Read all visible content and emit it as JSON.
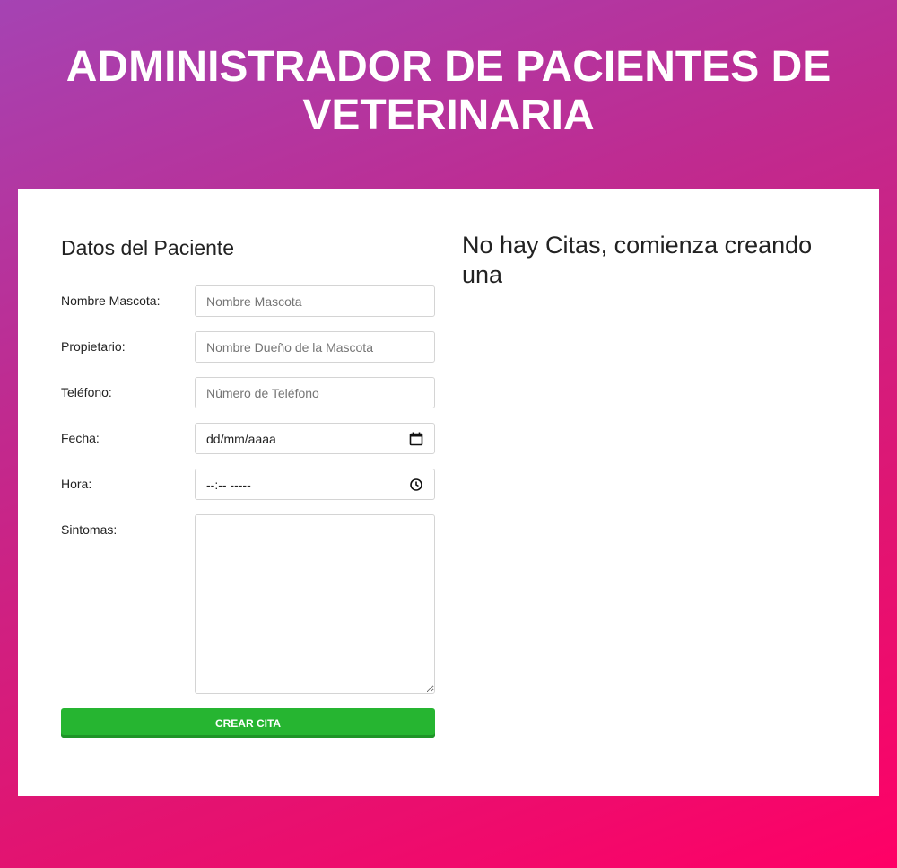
{
  "header": {
    "title": "ADMINISTRADOR DE PACIENTES DE VETERINARIA"
  },
  "form": {
    "section_title": "Datos del Paciente",
    "fields": {
      "mascota": {
        "label": "Nombre Mascota:",
        "placeholder": "Nombre Mascota"
      },
      "propietario": {
        "label": "Propietario:",
        "placeholder": "Nombre Dueño de la Mascota"
      },
      "telefono": {
        "label": "Teléfono:",
        "placeholder": "Número de Teléfono"
      },
      "fecha": {
        "label": "Fecha:",
        "value": "dd/mm/aaaa",
        "icon": "calendar-icon"
      },
      "hora": {
        "label": "Hora:",
        "value": "--:-- -----",
        "icon": "clock-icon"
      },
      "sintomas": {
        "label": "Sintomas:"
      }
    },
    "submit_label": "CREAR CITA"
  },
  "citas": {
    "empty_message": "No hay Citas, comienza creando una"
  },
  "colors": {
    "gradient_start": "#a543b3",
    "gradient_end": "#ff0066",
    "button_green": "#26b531",
    "panel_bg": "#ffffff"
  }
}
